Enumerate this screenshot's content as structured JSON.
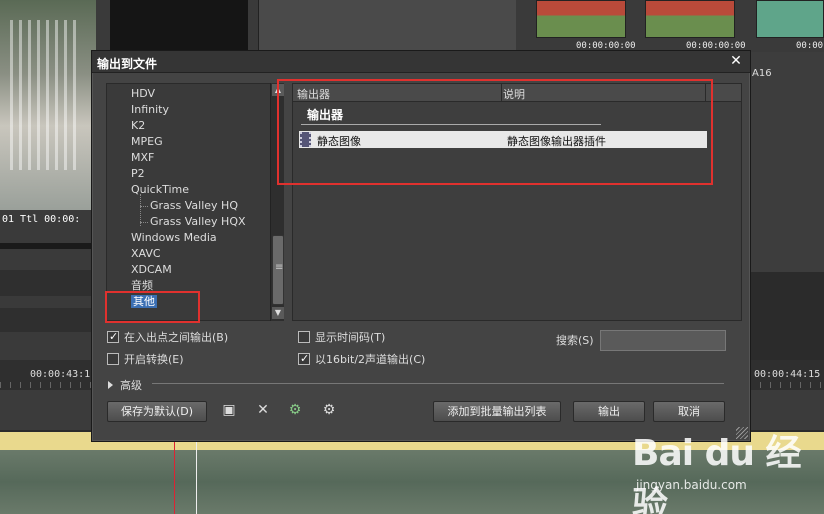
{
  "background": {
    "left_timecode": "01   Ttl 00:00:",
    "thumb_timecodes": [
      "00:00:00:00",
      "00:00:00:00",
      "00:00:"
    ],
    "track_label": "A16",
    "ruler_timecodes": [
      "00:00:43:1",
      "00:00:44:15"
    ]
  },
  "dialog": {
    "title": "输出到文件",
    "close_symbol": "✕",
    "tree": {
      "items": [
        {
          "label": "HDV",
          "child": false
        },
        {
          "label": "Infinity",
          "child": false
        },
        {
          "label": "K2",
          "child": false
        },
        {
          "label": "MPEG",
          "child": false
        },
        {
          "label": "MXF",
          "child": false
        },
        {
          "label": "P2",
          "child": false
        },
        {
          "label": "QuickTime",
          "child": false
        },
        {
          "label": "Grass Valley HQ",
          "child": true
        },
        {
          "label": "Grass Valley HQX",
          "child": true
        },
        {
          "label": "Windows Media",
          "child": false
        },
        {
          "label": "XAVC",
          "child": false
        },
        {
          "label": "XDCAM",
          "child": false
        },
        {
          "label": "音频",
          "child": false
        },
        {
          "label": "其他",
          "child": false
        }
      ],
      "selected": "其他"
    },
    "exporters": {
      "col_exporter": "输出器",
      "col_description": "说明",
      "group_label": "输出器",
      "rows": [
        {
          "name": "静态图像",
          "description": "静态图像输出器插件",
          "icon": "film-icon"
        }
      ]
    },
    "options": {
      "between_in_out": {
        "label": "在入出点之间输出(B)",
        "checked": true
      },
      "enable_convert": {
        "label": "开启转换(E)",
        "checked": false
      },
      "show_timecode": {
        "label": "显示时间码(T)",
        "checked": false
      },
      "output_16bit": {
        "label": "以16bit/2声道输出(C)",
        "checked": true
      }
    },
    "search": {
      "label": "搜索(S)",
      "value": ""
    },
    "advanced_label": "高级",
    "buttons": {
      "save_default": "保存为默认(D)",
      "add_batch": "添加到批量输出列表",
      "export": "输出",
      "cancel": "取消"
    },
    "icons": {
      "save": "💾",
      "delete": "✕",
      "preset1": "⚙",
      "preset2": "⚙"
    }
  },
  "watermark": {
    "main": "Bai du 经验",
    "sub": "jingyan.baidu.com"
  },
  "colors": {
    "highlight": "#e0312e",
    "selection": "#3b6fb3"
  }
}
